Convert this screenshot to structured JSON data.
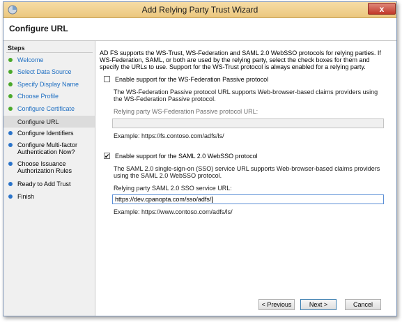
{
  "window": {
    "title": "Add Relying Party Trust Wizard",
    "close_label": "x"
  },
  "page": {
    "title": "Configure URL"
  },
  "steps": {
    "heading": "Steps",
    "items": [
      {
        "label": "Welcome",
        "state": "done"
      },
      {
        "label": "Select Data Source",
        "state": "done"
      },
      {
        "label": "Specify Display Name",
        "state": "done"
      },
      {
        "label": "Choose Profile",
        "state": "done"
      },
      {
        "label": "Configure Certificate",
        "state": "done"
      },
      {
        "label": "Configure URL",
        "state": "current"
      },
      {
        "label": "Configure Identifiers",
        "state": "todo"
      },
      {
        "label": "Configure Multi-factor Authentication Now?",
        "state": "todo"
      },
      {
        "label": "Choose Issuance Authorization Rules",
        "state": "todo"
      },
      {
        "label": "Ready to Add Trust",
        "state": "todo"
      },
      {
        "label": "Finish",
        "state": "todo"
      }
    ]
  },
  "main": {
    "intro": "AD FS supports the WS-Trust, WS-Federation and SAML 2.0 WebSSO protocols for relying parties. If WS-Federation, SAML, or both are used by the relying party, select the check boxes for them and specify the URLs to use. Support for the WS-Trust protocol is always enabled for a relying party.",
    "wsfed": {
      "checkbox_label": "Enable support for the WS-Federation Passive protocol",
      "checked": false,
      "description": "The WS-Federation Passive protocol URL supports Web-browser-based claims providers using the WS-Federation Passive protocol.",
      "field_label": "Relying party WS-Federation Passive protocol URL:",
      "value": "",
      "example": "Example: https://fs.contoso.com/adfs/ls/"
    },
    "saml": {
      "checkbox_label": "Enable support for the SAML 2.0 WebSSO protocol",
      "checked": true,
      "check_mark": "✔",
      "description": "The SAML 2.0 single-sign-on (SSO) service URL supports Web-browser-based claims providers using the SAML 2.0 WebSSO protocol.",
      "field_label": "Relying party SAML 2.0 SSO service URL:",
      "value": "https://dev.cpanopta.com/sso/adfs/",
      "example": "Example: https://www.contoso.com/adfs/ls/"
    }
  },
  "buttons": {
    "previous": "< Previous",
    "next": "Next >",
    "cancel": "Cancel"
  },
  "colors": {
    "title_bar": "#ebc77e",
    "close_button": "#c1382a",
    "step_done_dot": "#4aa82a",
    "step_todo_dot": "#2a73c9",
    "step_link": "#1d6ec2"
  }
}
